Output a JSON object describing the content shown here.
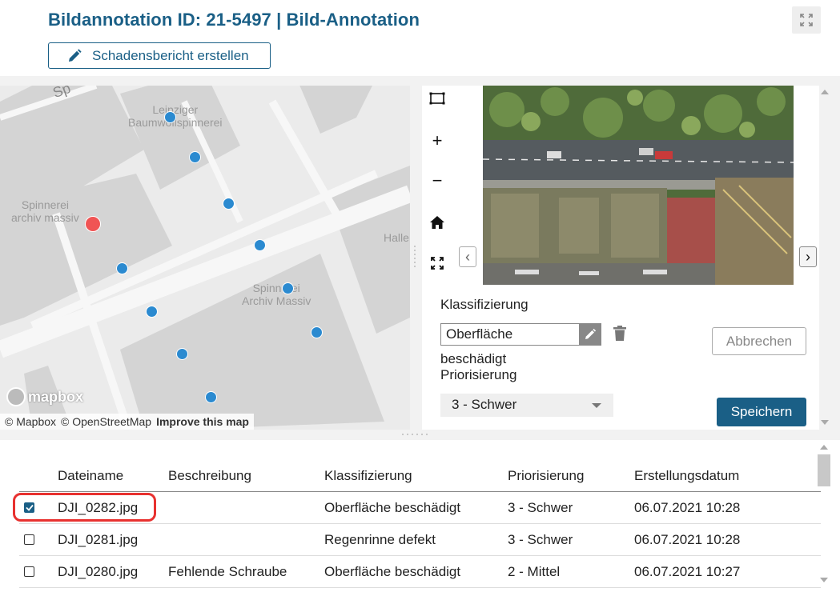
{
  "header": {
    "title": "Bildannotation ID: 21-5497 | Bild-Annotation",
    "report_button": "Schadensbericht erstellen",
    "expand_icon": "expand-icon"
  },
  "map": {
    "labels": {
      "leipziger": "Leipziger\nBaumwollspinnerei",
      "spinnerei_archiv": "Spinnerei\narchiv massiv",
      "spinnerei_archiv2": "Spinnerei\nArchiv Massiv",
      "halle": "Halle",
      "street": "Sp"
    },
    "logo": "mapbox",
    "attribution": {
      "mapbox": "© Mapbox",
      "osm": "© OpenStreetMap",
      "improve": "Improve this map"
    },
    "colors": {
      "marker": "#2b8ad0",
      "active_marker": "#f05454"
    }
  },
  "viewer": {
    "tools": [
      "select-rect-icon",
      "zoom-in-icon",
      "zoom-out-icon",
      "home-icon",
      "fullscreen-icon"
    ],
    "tool_glyphs": {
      "zoom_in": "+",
      "zoom_out": "−"
    },
    "prev": "‹",
    "next": "›"
  },
  "form": {
    "klassifizierung_label": "Klassifizierung",
    "klassifizierung_field": "Oberfläche",
    "klassifizierung_value": "beschädigt",
    "priorisierung_label": "Priorisierung",
    "priorisierung_value": "3 - Schwer",
    "cancel": "Abbrechen",
    "save": "Speichern",
    "accent": "#1a5f86"
  },
  "table": {
    "headers": [
      "Dateiname",
      "Beschreibung",
      "Klassifizierung",
      "Priorisierung",
      "Erstellungsdatum"
    ],
    "rows": [
      {
        "checked": true,
        "file": "DJI_0282.jpg",
        "desc": "",
        "klass": "Oberfläche beschädigt",
        "prio": "3 - Schwer",
        "date": "06.07.2021 10:28"
      },
      {
        "checked": false,
        "file": "DJI_0281.jpg",
        "desc": "",
        "klass": "Regenrinne defekt",
        "prio": "3 - Schwer",
        "date": "06.07.2021 10:28"
      },
      {
        "checked": false,
        "file": "DJI_0280.jpg",
        "desc": "Fehlende Schraube",
        "klass": "Oberfläche beschädigt",
        "prio": "2 - Mittel",
        "date": "06.07.2021 10:27"
      }
    ],
    "highlight_color": "#e8312f"
  }
}
